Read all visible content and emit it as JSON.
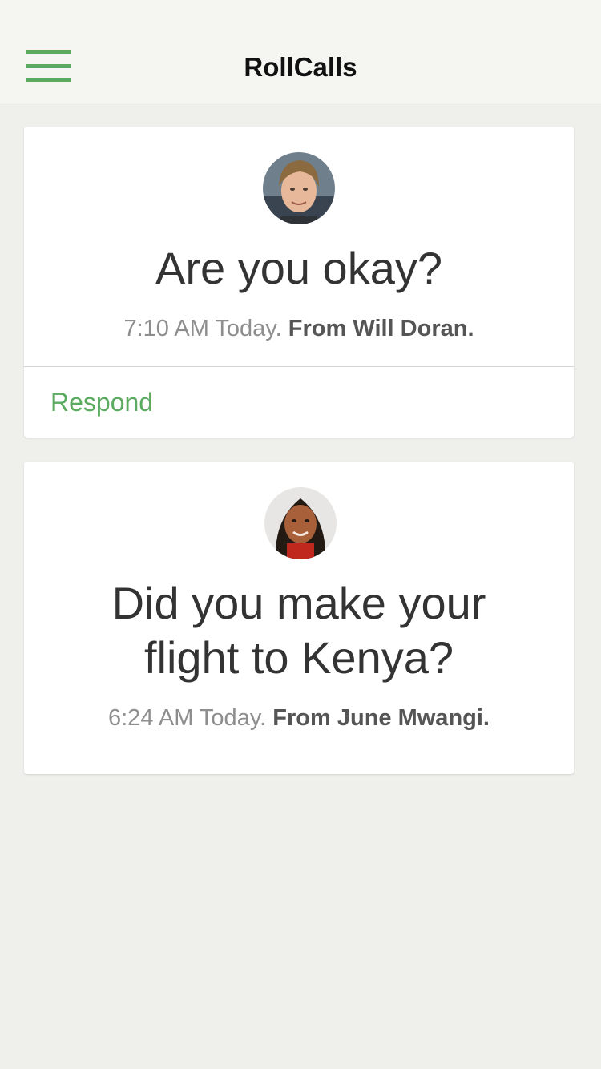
{
  "header": {
    "title": "RollCalls",
    "menu_icon": "hamburger-menu-icon",
    "accent_color": "#5aaa5f"
  },
  "rollcalls": [
    {
      "question": "Are you okay?",
      "time": "7:10 AM Today.",
      "from": "From Will Doran.",
      "action_label": "Respond",
      "avatar": "avatar-will-doran"
    },
    {
      "question": "Did you make your flight to Kenya?",
      "time": "6:24 AM Today.",
      "from": "From June Mwangi.",
      "avatar": "avatar-june-mwangi"
    }
  ]
}
